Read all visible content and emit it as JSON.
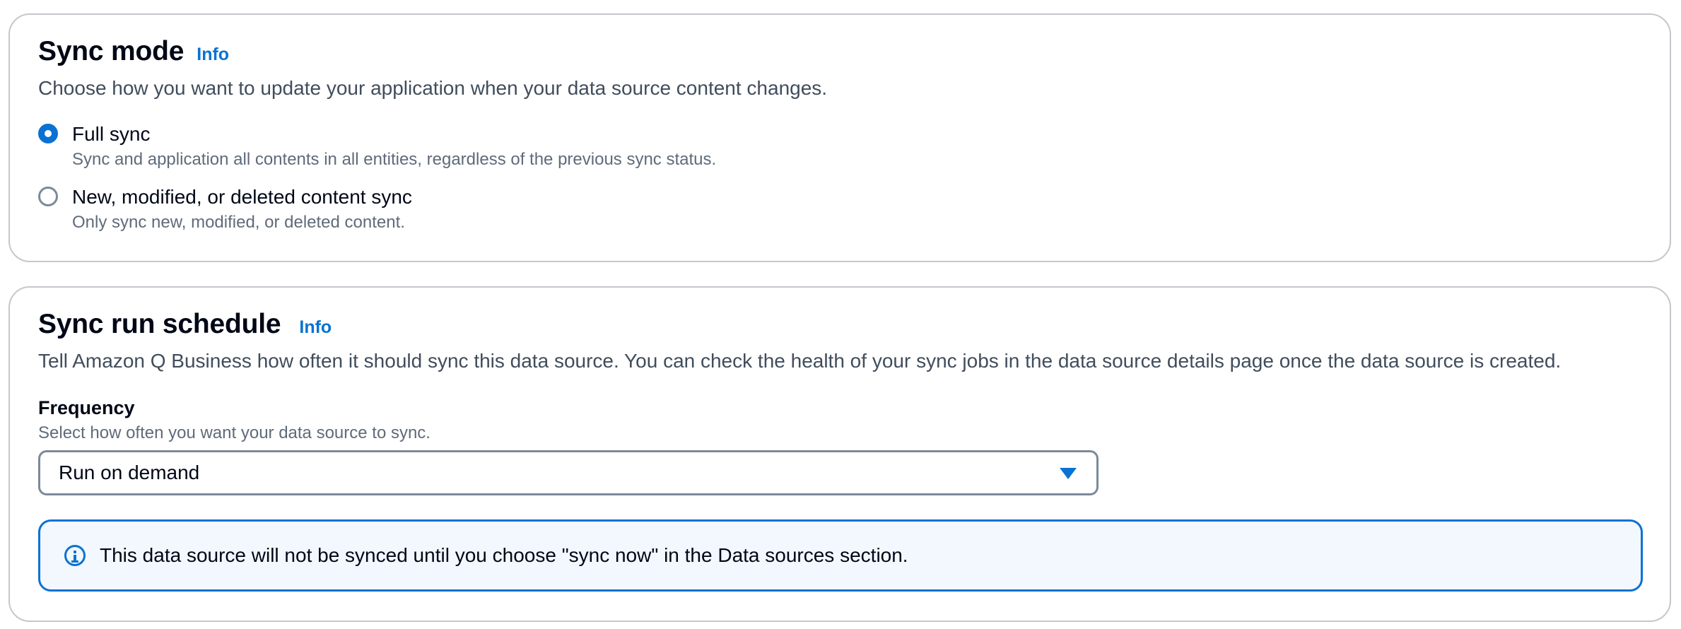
{
  "sync_mode": {
    "title": "Sync mode",
    "info_link": "Info",
    "description": "Choose how you want to update your application when your data source content changes.",
    "options": [
      {
        "label": "Full sync",
        "description": "Sync and application all contents in all entities, regardless of the previous sync status.",
        "selected": true
      },
      {
        "label": "New, modified, or deleted content sync",
        "description": "Only sync new, modified, or deleted content.",
        "selected": false
      }
    ]
  },
  "sync_run_schedule": {
    "title": "Sync run schedule",
    "info_link": "Info",
    "description": "Tell Amazon Q Business how often it should sync this data source. You can check the health of your sync jobs in the data source details page once the data source is created.",
    "frequency": {
      "label": "Frequency",
      "description": "Select how often you want your data source to sync.",
      "selected_value": "Run on demand"
    },
    "alert": {
      "icon": "info-icon",
      "text": "This data source will not be synced until you choose \"sync now\" in the Data sources section."
    }
  },
  "colors": {
    "accent": "#0972d3",
    "alert_background": "#f2f8fd",
    "border": "#c6c6cd",
    "text_primary": "#000716",
    "text_secondary": "#5f6b7a"
  }
}
